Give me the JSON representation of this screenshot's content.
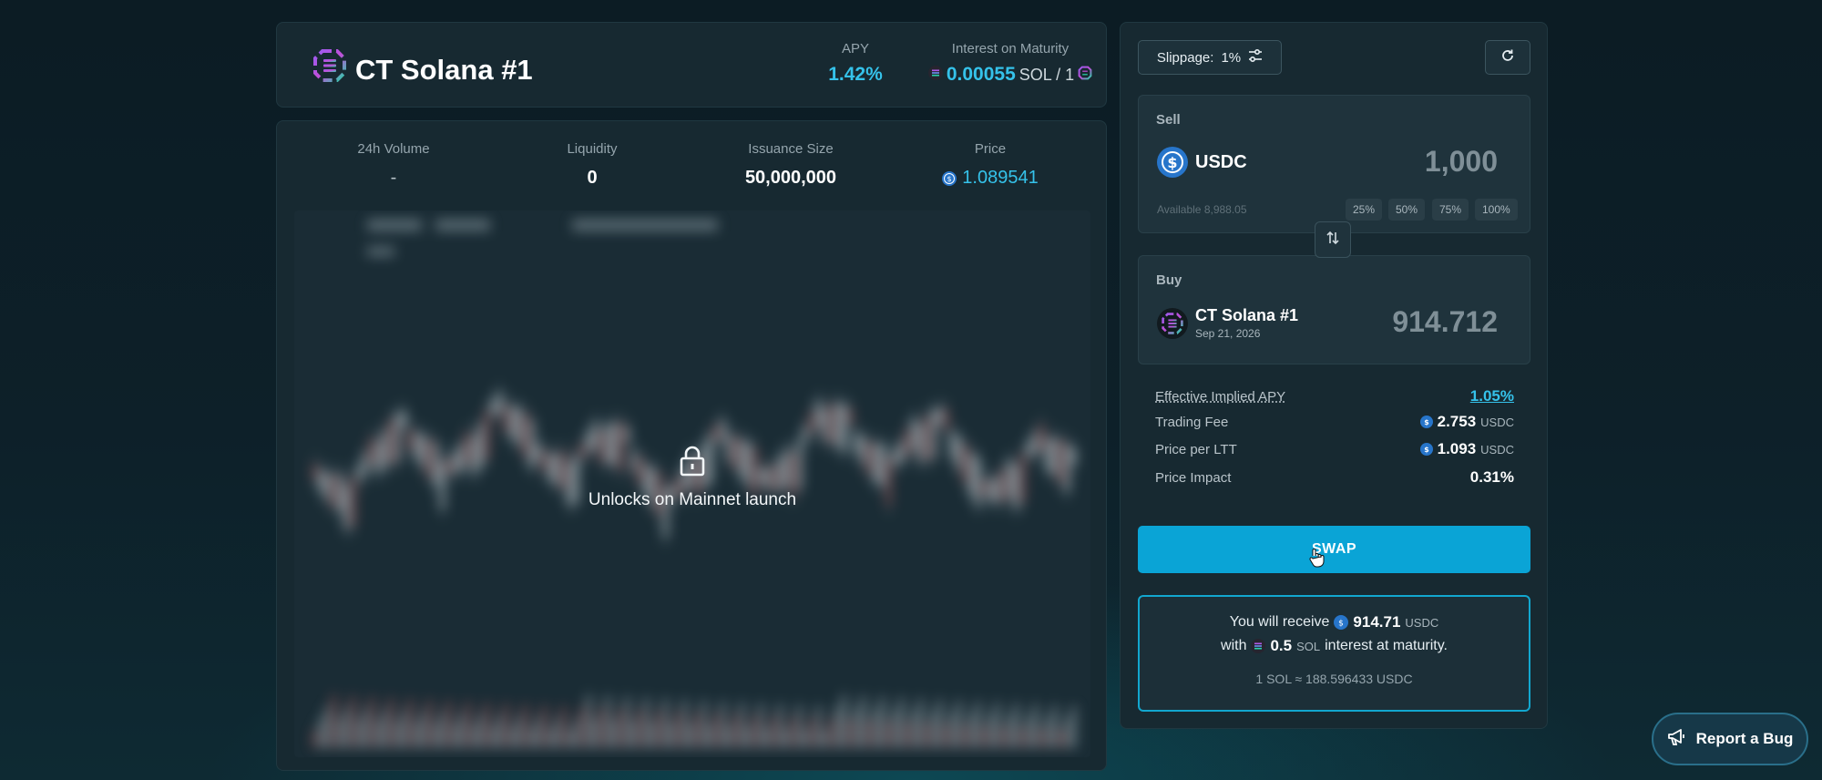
{
  "header": {
    "title": "CT Solana #1",
    "apy_label": "APY",
    "apy_value": "1.42%",
    "interest_label": "Interest on Maturity",
    "interest_value": "0.00055",
    "interest_unit": "SOL / 1"
  },
  "stats": {
    "volume_label": "24h Volume",
    "volume_value": "-",
    "liquidity_label": "Liquidity",
    "liquidity_value": "0",
    "issuance_label": "Issuance Size",
    "issuance_value": "50,000,000",
    "price_label": "Price",
    "price_value": "1.089541"
  },
  "chart": {
    "locked_text": "Unlocks on Mainnet launch"
  },
  "swap": {
    "slippage_label": "Slippage:",
    "slippage_value": "1%",
    "sell": {
      "label": "Sell",
      "token": "USDC",
      "amount": "1,000",
      "available": "Available 8,988.05",
      "percent_buttons": [
        "25%",
        "50%",
        "75%",
        "100%"
      ]
    },
    "buy": {
      "label": "Buy",
      "token": "CT Solana #1",
      "date": "Sep 21, 2026",
      "amount": "914.712"
    },
    "details": {
      "implied_apy_label": "Effective Implied APY",
      "implied_apy_value": "1.05%",
      "fee_label": "Trading Fee",
      "fee_value": "2.753",
      "fee_unit": "USDC",
      "price_ltt_label": "Price per LTT",
      "price_ltt_value": "1.093",
      "price_ltt_unit": "USDC",
      "impact_label": "Price Impact",
      "impact_value": "0.31%"
    },
    "swap_button": "SWAP",
    "receive": {
      "prefix": "You will receive",
      "amount": "914.71",
      "unit": "USDC",
      "with_label": "with",
      "interest_amount": "0.5",
      "interest_unit": "SOL",
      "suffix": "interest at maturity.",
      "rate": "1 SOL ≈ 188.596433 USDC"
    }
  },
  "report_bug": "Report a Bug",
  "colors": {
    "accent": "#35c2ea",
    "swap_button": "#0aa4d6",
    "card": "#172931"
  },
  "icons": [
    "ct-solana-logo-icon",
    "sol-icon",
    "usdc-icon",
    "sliders-icon",
    "refresh-icon",
    "swap-arrows-icon",
    "lock-icon",
    "cursor-icon",
    "megaphone-icon"
  ]
}
